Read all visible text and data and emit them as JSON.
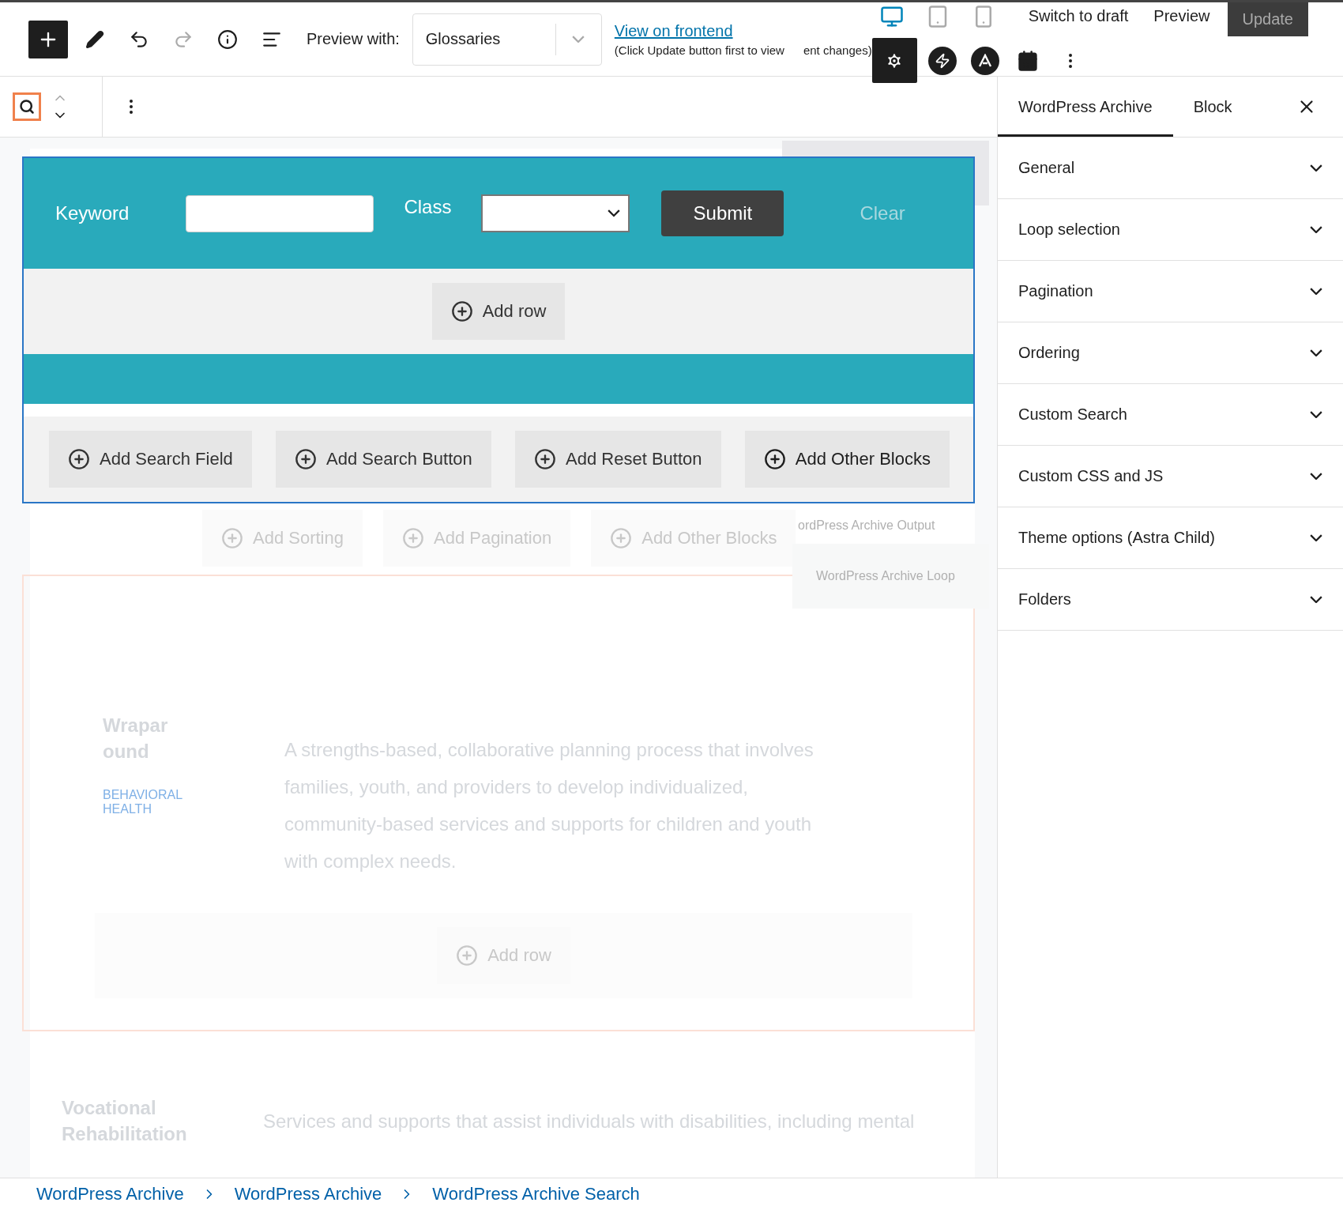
{
  "header": {
    "preview_label": "Preview with:",
    "preview_select": "Glossaries",
    "frontend_link": "View on frontend",
    "note_parts": [
      "(Click Update button first to view",
      "ent changes)"
    ],
    "devices": [
      {
        "kind": "desktop",
        "selected": true
      },
      {
        "kind": "tablet",
        "selected": false
      },
      {
        "kind": "mobile",
        "selected": false
      }
    ],
    "actions": [
      {
        "kind": "link",
        "label": "Switch to draft"
      },
      {
        "kind": "link",
        "label": "Preview"
      },
      {
        "kind": "primary",
        "label": "Update",
        "disabled": true
      }
    ],
    "plugins": [
      {
        "kind": "gear",
        "selected": true
      },
      {
        "kind": "bolt",
        "selected": false
      },
      {
        "kind": "astra",
        "selected": false
      },
      {
        "kind": "calendar",
        "selected": false
      },
      {
        "kind": "more",
        "selected": false
      }
    ]
  },
  "search_form": {
    "fields": [
      {
        "kind": "text",
        "label": "Keyword"
      },
      {
        "kind": "select",
        "label": "Class"
      }
    ],
    "submit": "Submit",
    "clear": "Clear",
    "add_row": "Add row",
    "add_buttons": [
      "Add Search Field",
      "Add Search Button",
      "Add Reset Button",
      "Add Other Blocks"
    ]
  },
  "output_buttons": [
    "Add Sorting",
    "Add Pagination",
    "Add Other Blocks"
  ],
  "block_labels": [
    "ordPress Archive Output",
    "WordPress Archive Loop"
  ],
  "loop_items": [
    {
      "title": "Wraparound",
      "category": "BEHAVIORAL HEALTH",
      "description": "A strengths-based, collaborative planning process that involves families, youth, and providers to develop individualized, community-based services and supports for children and youth with complex needs.",
      "add_row": "Add row"
    },
    {
      "title": "Vocational Rehabilitation",
      "description": "Services and supports that assist individuals with disabilities, including mental"
    }
  ],
  "sidebar": {
    "tabs": [
      {
        "label": "WordPress Archive",
        "selected": true
      },
      {
        "label": "Block",
        "selected": false
      }
    ],
    "panels": [
      {
        "title": "General",
        "expanded": false
      },
      {
        "title": "Loop selection",
        "expanded": false
      },
      {
        "title": "Pagination",
        "expanded": false
      },
      {
        "title": "Ordering",
        "expanded": false
      },
      {
        "title": "Custom Search",
        "expanded": false
      },
      {
        "title": "Custom CSS and JS",
        "expanded": false
      },
      {
        "title": "Theme options (Astra Child)",
        "expanded": false
      },
      {
        "title": "Folders",
        "expanded": false
      }
    ]
  },
  "breadcrumb": [
    "WordPress Archive",
    "WordPress Archive",
    "WordPress Archive Search"
  ]
}
